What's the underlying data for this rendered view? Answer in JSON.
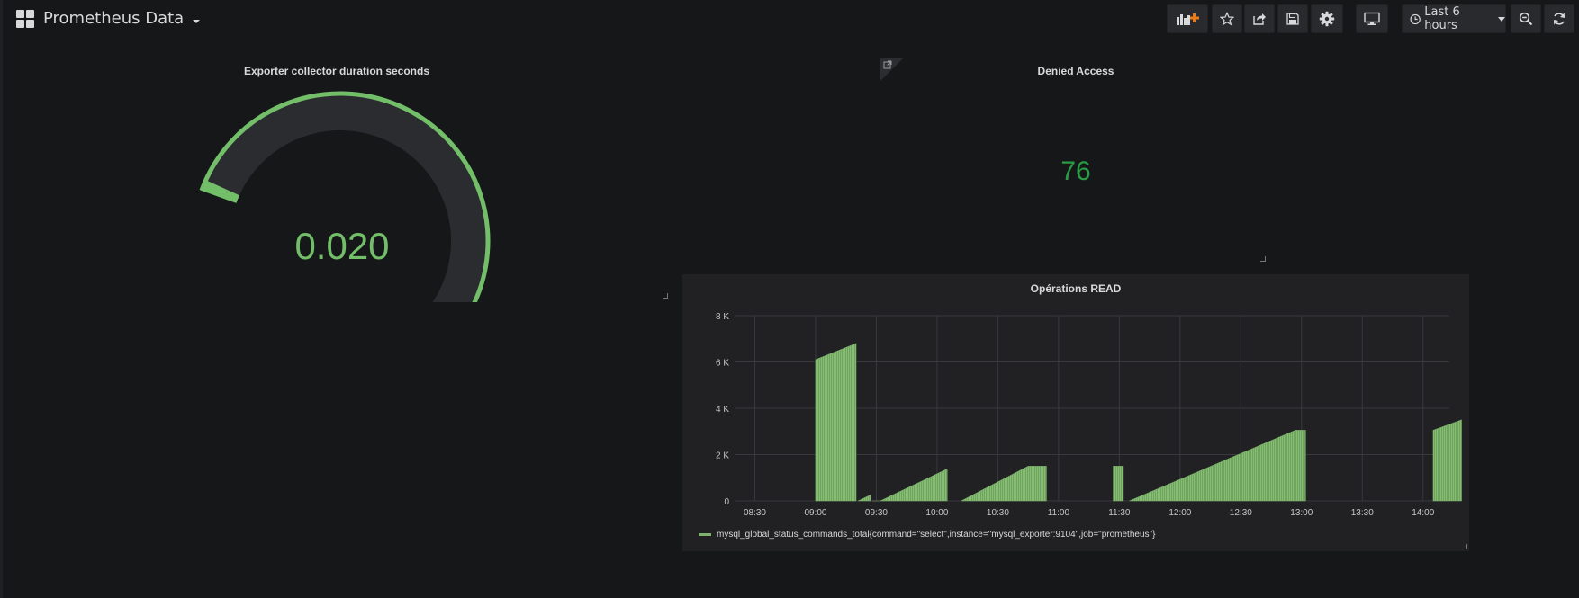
{
  "header": {
    "dashboard_title": "Prometheus Data",
    "buttons": [
      {
        "name": "add-panel-button",
        "icon": "add-panel-icon"
      },
      {
        "name": "star-button",
        "icon": "star-icon"
      },
      {
        "name": "share-button",
        "icon": "share-icon"
      },
      {
        "name": "save-button",
        "icon": "save-icon"
      },
      {
        "name": "settings-button",
        "icon": "gear-icon"
      },
      {
        "name": "tv-mode-button",
        "icon": "monitor-icon"
      },
      {
        "name": "zoom-out-button",
        "icon": "zoom-out-icon"
      },
      {
        "name": "refresh-button",
        "icon": "refresh-icon"
      }
    ],
    "time_picker_label": "Last 6 hours"
  },
  "gauge_panel": {
    "title": "Exporter collector duration seconds",
    "value_text": "0.020",
    "value": 0.02,
    "value_fraction": 0.02,
    "threshold_fraction": 0.85,
    "colors": {
      "ok": "#73bf69",
      "bad": "#f2495c",
      "track": "#2b2c2f"
    }
  },
  "stat_panel": {
    "title": "Denied Access",
    "value": "76",
    "color": "#299c46"
  },
  "graph_panel": {
    "title": "Opérations READ",
    "legend": "mysql_global_status_commands_total{command=\"select\",instance=\"mysql_exporter:9104\",job=\"prometheus\"}"
  },
  "chart_data": {
    "type": "area",
    "title": "Opérations READ",
    "xlabel": "",
    "ylabel": "",
    "x_ticks": [
      "08:30",
      "09:00",
      "09:30",
      "10:00",
      "10:30",
      "11:00",
      "11:30",
      "12:00",
      "12:30",
      "13:00",
      "13:30",
      "14:00"
    ],
    "y_ticks": [
      "0",
      "2 K",
      "4 K",
      "6 K",
      "8 K"
    ],
    "ylim": [
      0,
      8000
    ],
    "xlim": [
      "08:20",
      "14:13"
    ],
    "grid": true,
    "legend_position": "bottom-left",
    "color": "#7eb26d",
    "series": [
      {
        "name": "mysql_global_status_commands_total{command=\"select\",instance=\"mysql_exporter:9104\",job=\"prometheus\"}",
        "segments": [
          [
            [
              "09:00",
              6100
            ],
            [
              "09:20",
              6800
            ]
          ],
          [
            [
              "09:21",
              0
            ],
            [
              "09:27",
              250
            ]
          ],
          [
            [
              "09:28",
              0
            ],
            [
              "09:32",
              0
            ],
            [
              "10:05",
              1380
            ]
          ],
          [
            [
              "10:12",
              0
            ],
            [
              "10:45",
              1500
            ],
            [
              "10:54",
              1500
            ]
          ],
          [
            [
              "11:27",
              1500
            ],
            [
              "11:32",
              1500
            ]
          ],
          [
            [
              "11:35",
              0
            ],
            [
              "12:57",
              3050
            ],
            [
              "13:02",
              3050
            ]
          ],
          [
            [
              "14:05",
              3050
            ],
            [
              "14:19",
              3500
            ]
          ]
        ]
      }
    ]
  }
}
